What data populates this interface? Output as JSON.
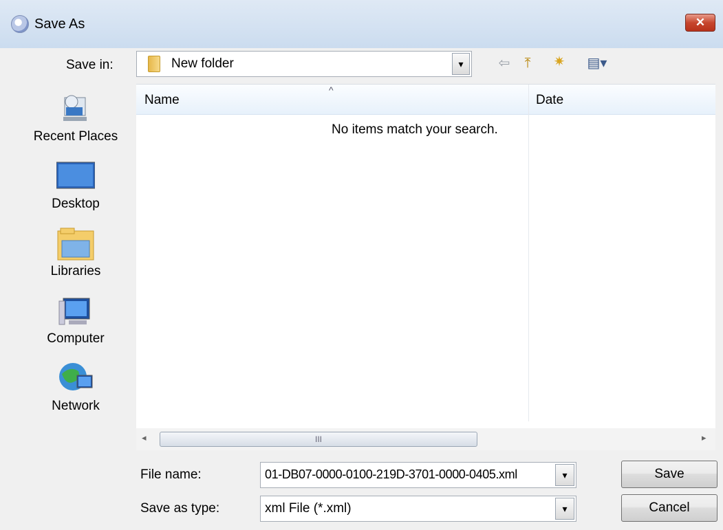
{
  "window": {
    "title": "Save As",
    "close_glyph": "✕"
  },
  "save_in": {
    "label": "Save in:",
    "value": "New folder",
    "icon": "folder-icon",
    "dropdown_glyph": "▾"
  },
  "toolbar": {
    "back_glyph": "⇦",
    "up_glyph": "⤒",
    "new_folder_glyph": "✷",
    "views_glyph": "▤▾"
  },
  "places": [
    {
      "label": "Recent Places",
      "icon": "recent-places-icon"
    },
    {
      "label": "Desktop",
      "icon": "desktop-icon"
    },
    {
      "label": "Libraries",
      "icon": "libraries-icon"
    },
    {
      "label": "Computer",
      "icon": "computer-icon"
    },
    {
      "label": "Network",
      "icon": "network-icon"
    }
  ],
  "file_list": {
    "columns": [
      "Name",
      "Date"
    ],
    "sort_glyph": "^",
    "empty_message": "No items match your search.",
    "scroll_left": "◂",
    "scroll_right": "▸",
    "thumb_grip": "III"
  },
  "file_name": {
    "label": "File name:",
    "value": "01-DB07-0000-0100-219D-3701-0000-0405.xml"
  },
  "save_type": {
    "label": "Save as type:",
    "value": "xml File (*.xml)"
  },
  "buttons": {
    "save": "Save",
    "cancel": "Cancel"
  }
}
